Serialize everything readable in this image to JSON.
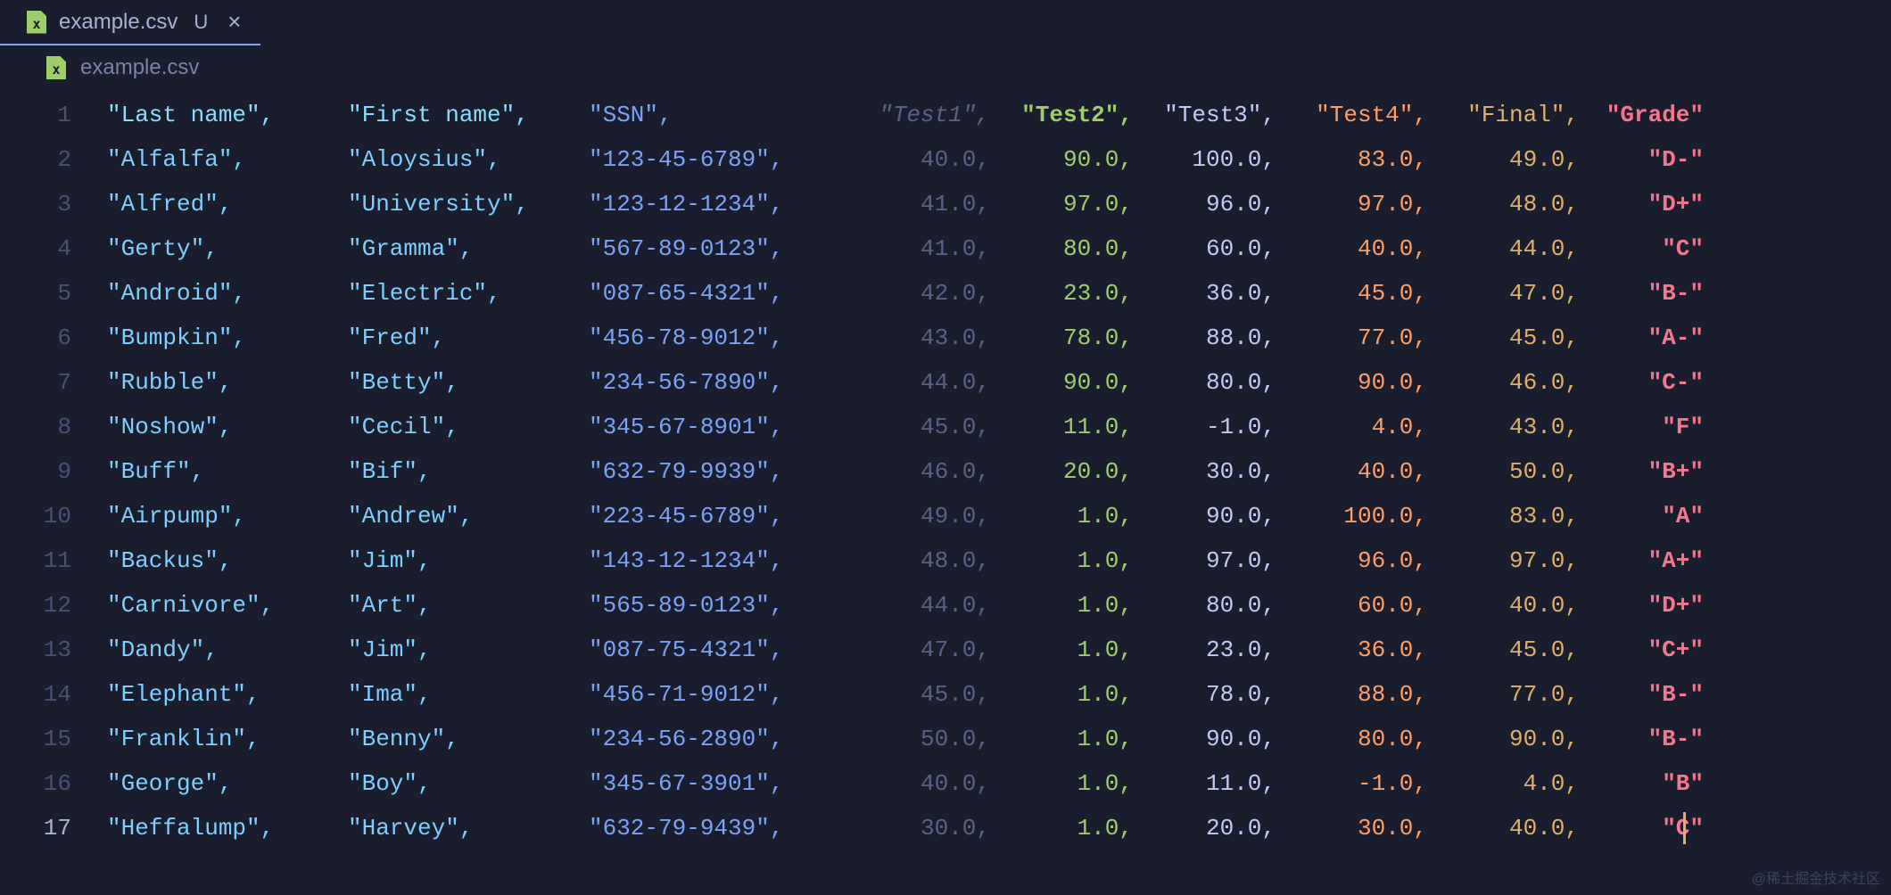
{
  "tab": {
    "filename": "example.csv",
    "unsaved_indicator": "U",
    "close_glyph": "×"
  },
  "breadcrumb": {
    "filename": "example.csv"
  },
  "columns": [
    "Last name",
    "First name",
    "SSN",
    "Test1",
    "Test2",
    "Test3",
    "Test4",
    "Final",
    "Grade"
  ],
  "rows": [
    {
      "last": "Alfalfa",
      "first": "Aloysius",
      "ssn": "123-45-6789",
      "t1": "40.0",
      "t2": "90.0",
      "t3": "100.0",
      "t4": "83.0",
      "final": "49.0",
      "grade": "D-"
    },
    {
      "last": "Alfred",
      "first": "University",
      "ssn": "123-12-1234",
      "t1": "41.0",
      "t2": "97.0",
      "t3": "96.0",
      "t4": "97.0",
      "final": "48.0",
      "grade": "D+"
    },
    {
      "last": "Gerty",
      "first": "Gramma",
      "ssn": "567-89-0123",
      "t1": "41.0",
      "t2": "80.0",
      "t3": "60.0",
      "t4": "40.0",
      "final": "44.0",
      "grade": "C"
    },
    {
      "last": "Android",
      "first": "Electric",
      "ssn": "087-65-4321",
      "t1": "42.0",
      "t2": "23.0",
      "t3": "36.0",
      "t4": "45.0",
      "final": "47.0",
      "grade": "B-"
    },
    {
      "last": "Bumpkin",
      "first": "Fred",
      "ssn": "456-78-9012",
      "t1": "43.0",
      "t2": "78.0",
      "t3": "88.0",
      "t4": "77.0",
      "final": "45.0",
      "grade": "A-"
    },
    {
      "last": "Rubble",
      "first": "Betty",
      "ssn": "234-56-7890",
      "t1": "44.0",
      "t2": "90.0",
      "t3": "80.0",
      "t4": "90.0",
      "final": "46.0",
      "grade": "C-"
    },
    {
      "last": "Noshow",
      "first": "Cecil",
      "ssn": "345-67-8901",
      "t1": "45.0",
      "t2": "11.0",
      "t3": "-1.0",
      "t4": "4.0",
      "final": "43.0",
      "grade": "F"
    },
    {
      "last": "Buff",
      "first": "Bif",
      "ssn": "632-79-9939",
      "t1": "46.0",
      "t2": "20.0",
      "t3": "30.0",
      "t4": "40.0",
      "final": "50.0",
      "grade": "B+"
    },
    {
      "last": "Airpump",
      "first": "Andrew",
      "ssn": "223-45-6789",
      "t1": "49.0",
      "t2": "1.0",
      "t3": "90.0",
      "t4": "100.0",
      "final": "83.0",
      "grade": "A"
    },
    {
      "last": "Backus",
      "first": "Jim",
      "ssn": "143-12-1234",
      "t1": "48.0",
      "t2": "1.0",
      "t3": "97.0",
      "t4": "96.0",
      "final": "97.0",
      "grade": "A+"
    },
    {
      "last": "Carnivore",
      "first": "Art",
      "ssn": "565-89-0123",
      "t1": "44.0",
      "t2": "1.0",
      "t3": "80.0",
      "t4": "60.0",
      "final": "40.0",
      "grade": "D+"
    },
    {
      "last": "Dandy",
      "first": "Jim",
      "ssn": "087-75-4321",
      "t1": "47.0",
      "t2": "1.0",
      "t3": "23.0",
      "t4": "36.0",
      "final": "45.0",
      "grade": "C+"
    },
    {
      "last": "Elephant",
      "first": "Ima",
      "ssn": "456-71-9012",
      "t1": "45.0",
      "t2": "1.0",
      "t3": "78.0",
      "t4": "88.0",
      "final": "77.0",
      "grade": "B-"
    },
    {
      "last": "Franklin",
      "first": "Benny",
      "ssn": "234-56-2890",
      "t1": "50.0",
      "t2": "1.0",
      "t3": "90.0",
      "t4": "80.0",
      "final": "90.0",
      "grade": "B-"
    },
    {
      "last": "George",
      "first": "Boy",
      "ssn": "345-67-3901",
      "t1": "40.0",
      "t2": "1.0",
      "t3": "11.0",
      "t4": "-1.0",
      "final": "4.0",
      "grade": "B"
    },
    {
      "last": "Heffalump",
      "first": "Harvey",
      "ssn": "632-79-9439",
      "t1": "30.0",
      "t2": "1.0",
      "t3": "20.0",
      "t4": "30.0",
      "final": "40.0",
      "grade": "C"
    }
  ],
  "active_line": 17,
  "watermark": "@稀土掘金技术社区"
}
